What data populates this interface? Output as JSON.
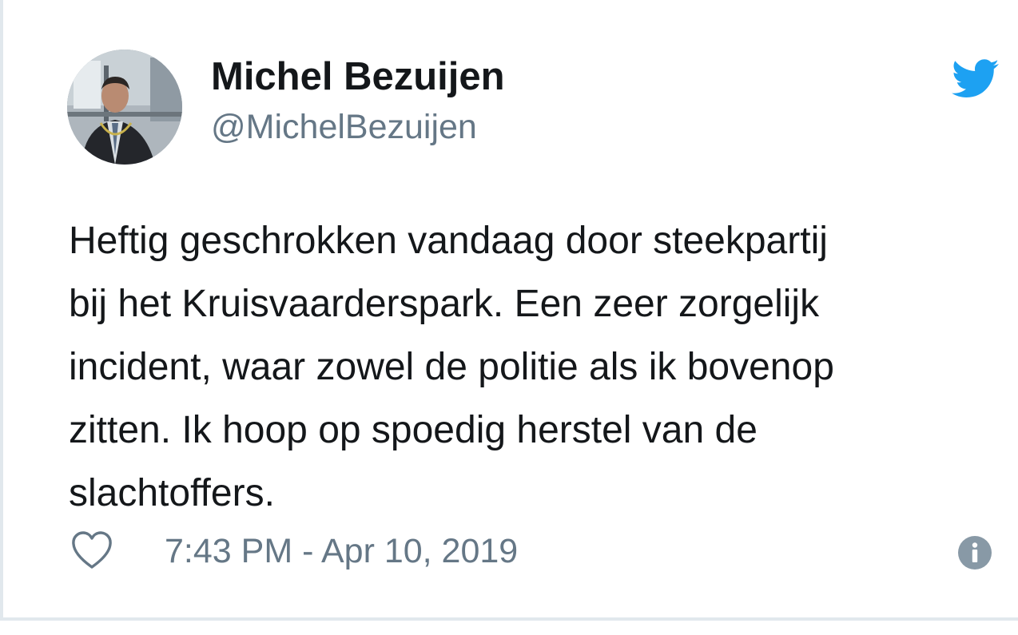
{
  "tweet": {
    "author": {
      "display_name": "Michel Bezuijen",
      "handle": "@MichelBezuijen",
      "avatar_icon": "profile-photo"
    },
    "text": "Heftig geschrokken vandaag door steekpartij\nbij het Kruisvaarderspark. Een zeer zorgelijk\nincident, waar zowel de politie als ik bovenop\nzitten. Ik hoop op spoedig herstel van de\nslachtoffers.",
    "timestamp": "7:43 PM - Apr 10, 2019",
    "icons": {
      "brand": "twitter-bird-icon",
      "like": "heart-icon",
      "info": "info-icon"
    }
  },
  "colors": {
    "twitter_blue": "#1da1f2",
    "text_primary": "#14171a",
    "text_secondary": "#657786",
    "border": "#e1e8ed"
  }
}
